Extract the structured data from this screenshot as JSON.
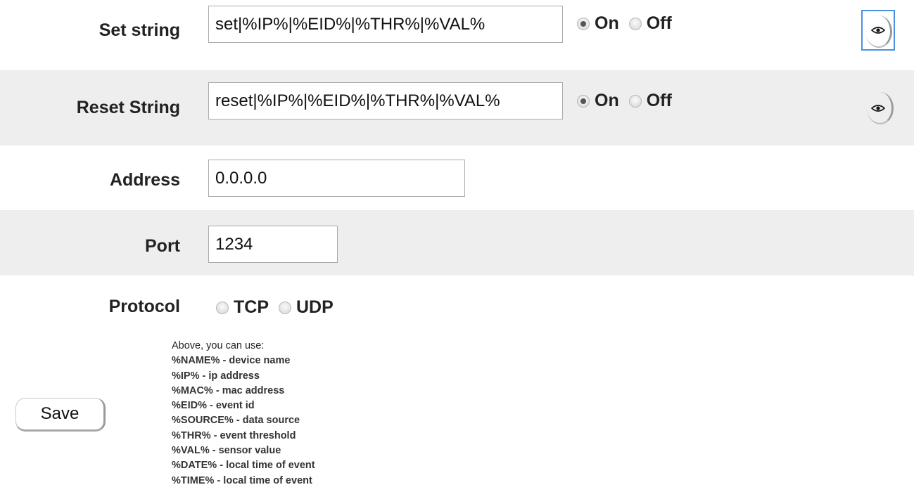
{
  "set_string": {
    "label": "Set string",
    "value": "set|%IP%|%EID%|%THR%|%VAL%",
    "on_label": "On",
    "off_label": "Off",
    "selected": "on"
  },
  "reset_string": {
    "label": "Reset String",
    "value": "reset|%IP%|%EID%|%THR%|%VAL%",
    "on_label": "On",
    "off_label": "Off",
    "selected": "on"
  },
  "address": {
    "label": "Address",
    "value": "0.0.0.0"
  },
  "port": {
    "label": "Port",
    "value": "1234"
  },
  "protocol": {
    "label": "Protocol",
    "tcp_label": "TCP",
    "udp_label": "UDP",
    "selected": "none"
  },
  "save_label": "Save",
  "help": {
    "title": "Above, you can use:",
    "items": [
      "%NAME% - device name",
      "%IP% - ip address",
      "%MAC% - mac address",
      "%EID% - event id",
      "%SOURCE% - data source",
      "%THR% - event threshold",
      "%VAL% - sensor value",
      "%DATE% - local time of event",
      "%TIME% - local time of event"
    ]
  },
  "icons": {
    "preview": "eye-icon"
  },
  "colors": {
    "row_shade": "#eeeeee",
    "focus_ring": "#4a8fe0"
  }
}
